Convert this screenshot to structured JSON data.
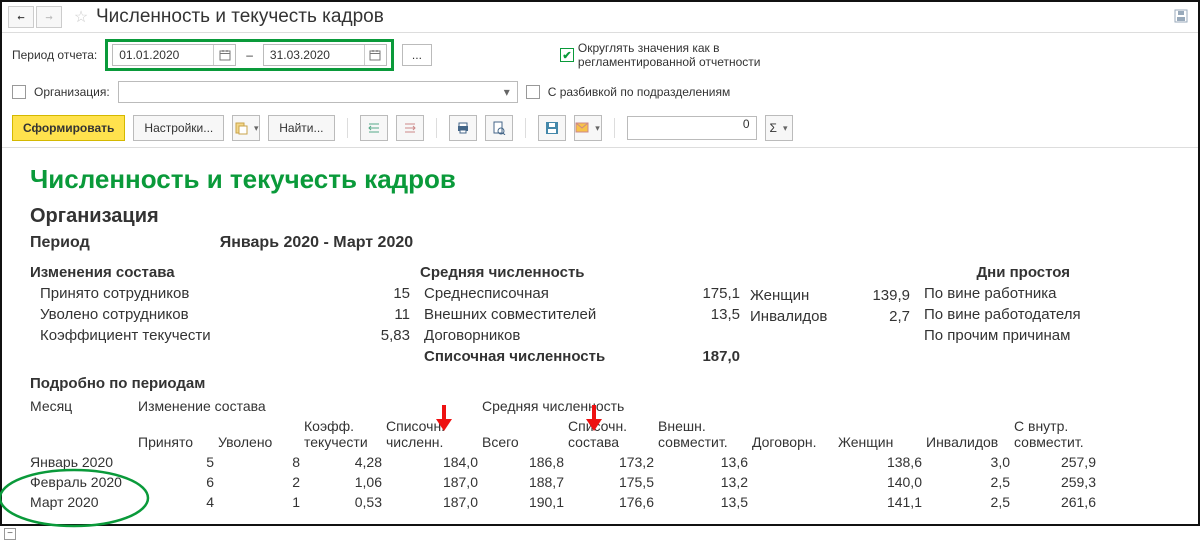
{
  "title": "Численность и текучесть кадров",
  "period_label": "Период отчета:",
  "date_from": "01.01.2020",
  "date_to": "31.03.2020",
  "dash": "–",
  "round_label": "Округлять значения как в регламентированной отчетности",
  "org_label": "Организация:",
  "org_value": "",
  "breakdown_label": "С разбивкой по подразделениям",
  "toolbar": {
    "form": "Сформировать",
    "settings": "Настройки...",
    "find": "Найти..."
  },
  "zero": "0",
  "report": {
    "title": "Численность и текучесть кадров",
    "org": "Организация",
    "period_l": "Период",
    "period_v": "Январь 2020 - Март 2020",
    "changes_h": "Изменения состава",
    "hired_l": "Принято сотрудников",
    "hired_v": "15",
    "fired_l": "Уволено сотрудников",
    "fired_v": "11",
    "coef_l": "Коэффициент текучести",
    "coef_v": "5,83",
    "avg_h": "Средняя численность",
    "avg1_l": "Среднесписочная",
    "avg1_v": "175,1",
    "avg2_l": "Внешних совместителей",
    "avg2_v": "13,5",
    "avg3_l": "Договорников",
    "list_h": "Списочная численность",
    "list_v": "187,0",
    "wom_l": "Женщин",
    "wom_v": "139,9",
    "inv_l": "Инвалидов",
    "inv_v": "2,7",
    "idle_h": "Дни простоя",
    "idle1": "По вине работника",
    "idle2": "По вине работодателя",
    "idle3": "По прочим причинам",
    "detail_h": "Подробно по периодам",
    "cols": {
      "month": "Месяц",
      "change": "Изменение состава",
      "hired": "Принято",
      "fired": "Уволено",
      "coef": "Коэфф. текучести",
      "list": "Списочн. численн.",
      "avg": "Средняя численность",
      "total": "Всего",
      "sost": "Списочн. состава",
      "ext": "Внешн. совместит.",
      "dog": "Договорн.",
      "wom": "Женщин",
      "inv": "Инвалидов",
      "intr": "С внутр. совместит."
    },
    "rows": [
      {
        "m": "Январь 2020",
        "h": "5",
        "f": "8",
        "c": "4,28",
        "l": "184,0",
        "t": "186,8",
        "s": "173,2",
        "e": "13,6",
        "d": "",
        "w": "138,6",
        "i": "3,0",
        "n": "257,9"
      },
      {
        "m": "Февраль 2020",
        "h": "6",
        "f": "2",
        "c": "1,06",
        "l": "187,0",
        "t": "188,7",
        "s": "175,5",
        "e": "13,2",
        "d": "",
        "w": "140,0",
        "i": "2,5",
        "n": "259,3"
      },
      {
        "m": "Март 2020",
        "h": "4",
        "f": "1",
        "c": "0,53",
        "l": "187,0",
        "t": "190,1",
        "s": "176,6",
        "e": "13,5",
        "d": "",
        "w": "141,1",
        "i": "2,5",
        "n": "261,6"
      }
    ]
  }
}
